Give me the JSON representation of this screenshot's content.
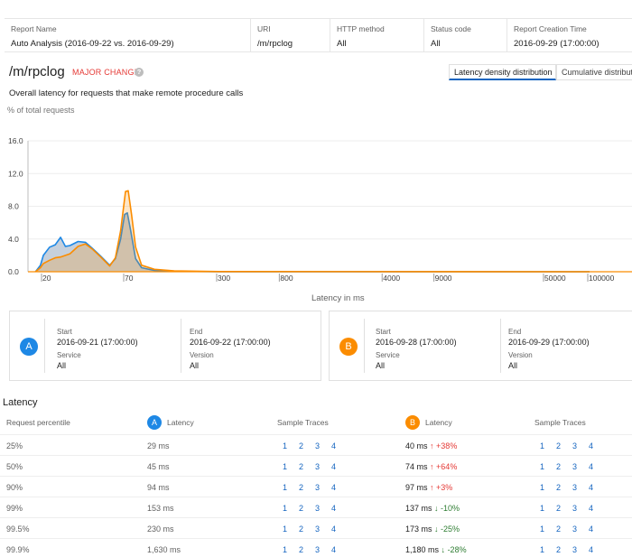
{
  "header": {
    "columns": [
      {
        "label": "Report Name",
        "value": "Auto Analysis (2016-09-22 vs. 2016-09-29)"
      },
      {
        "label": "URI",
        "value": "/m/rpclog"
      },
      {
        "label": "HTTP method",
        "value": "All"
      },
      {
        "label": "Status code",
        "value": "All"
      },
      {
        "label": "Report Creation Time",
        "value": "2016-09-29 (17:00:00)"
      }
    ]
  },
  "page": {
    "title": "/m/rpclog",
    "badge": "MAJOR CHANGE",
    "help_glyph": "?",
    "subtitle": "Overall latency for requests that make remote procedure calls",
    "toggle_density": "Latency density distribution",
    "toggle_cumulative": "Cumulative distributi"
  },
  "chart_data": {
    "type": "area",
    "ylabel": "% of total requests",
    "xlabel": "Latency in ms",
    "y_ticks": [
      "16.0",
      "12.0",
      "8.0",
      "4.0",
      "0.0"
    ],
    "ylim": [
      0,
      16
    ],
    "x_ticks": [
      "20",
      "70",
      "300",
      "800",
      "4000",
      "9000",
      "50000",
      "100000"
    ],
    "x_scale": "log",
    "series": [
      {
        "color": "#1e88e5",
        "points": [
          [
            15,
            0
          ],
          [
            18,
            0.8
          ],
          [
            20,
            2.0
          ],
          [
            22,
            3.0
          ],
          [
            24,
            3.3
          ],
          [
            26,
            4.2
          ],
          [
            28,
            3.1
          ],
          [
            30,
            3.2
          ],
          [
            34,
            3.7
          ],
          [
            38,
            3.6
          ],
          [
            42,
            2.9
          ],
          [
            48,
            1.9
          ],
          [
            55,
            0.8
          ],
          [
            60,
            1.6
          ],
          [
            65,
            4.0
          ],
          [
            69,
            7.0
          ],
          [
            72,
            7.2
          ],
          [
            76,
            5.0
          ],
          [
            82,
            1.6
          ],
          [
            90,
            0.5
          ],
          [
            110,
            0.15
          ],
          [
            150,
            0.05
          ],
          [
            300,
            0
          ],
          [
            100000,
            0
          ]
        ]
      },
      {
        "color": "#fb8c00",
        "points": [
          [
            15,
            0
          ],
          [
            18,
            0.5
          ],
          [
            20,
            1.0
          ],
          [
            22,
            1.4
          ],
          [
            24,
            1.7
          ],
          [
            26,
            1.8
          ],
          [
            30,
            2.2
          ],
          [
            34,
            3.1
          ],
          [
            38,
            3.4
          ],
          [
            42,
            2.8
          ],
          [
            48,
            1.8
          ],
          [
            55,
            0.7
          ],
          [
            60,
            1.7
          ],
          [
            65,
            5.0
          ],
          [
            70,
            9.8
          ],
          [
            73,
            9.9
          ],
          [
            77,
            7.0
          ],
          [
            82,
            3.0
          ],
          [
            90,
            0.8
          ],
          [
            110,
            0.3
          ],
          [
            150,
            0.1
          ],
          [
            300,
            0.02
          ],
          [
            100000,
            0
          ]
        ]
      }
    ]
  },
  "snapshots": {
    "a": {
      "letter": "A",
      "start_label": "Start",
      "start": "2016-09-21 (17:00:00)",
      "end_label": "End",
      "end": "2016-09-22 (17:00:00)",
      "service_label": "Service",
      "service": "All",
      "version_label": "Version",
      "version": "All"
    },
    "b": {
      "letter": "B",
      "start_label": "Start",
      "start": "2016-09-28 (17:00:00)",
      "end_label": "End",
      "end": "2016-09-29 (17:00:00)",
      "service_label": "Service",
      "service": "All",
      "version_label": "Version",
      "version": "All"
    }
  },
  "latency": {
    "title": "Latency",
    "headers": {
      "percentile": "Request percentile",
      "latency_a": "Latency",
      "traces_a": "Sample Traces",
      "latency_b": "Latency",
      "traces_b": "Sample Traces"
    },
    "trace_links": [
      "1",
      "2",
      "3",
      "4"
    ],
    "rows": [
      {
        "percentile": "25%",
        "a": "29 ms",
        "b": "40 ms",
        "arrow": "↑",
        "change": "+38%",
        "dir": "up"
      },
      {
        "percentile": "50%",
        "a": "45 ms",
        "b": "74 ms",
        "arrow": "↑",
        "change": "+64%",
        "dir": "up"
      },
      {
        "percentile": "90%",
        "a": "94 ms",
        "b": "97 ms",
        "arrow": "↑",
        "change": "+3%",
        "dir": "up"
      },
      {
        "percentile": "99%",
        "a": "153 ms",
        "b": "137 ms",
        "arrow": "↓",
        "change": "-10%",
        "dir": "down"
      },
      {
        "percentile": "99.5%",
        "a": "230 ms",
        "b": "173 ms",
        "arrow": "↓",
        "change": "-25%",
        "dir": "down"
      },
      {
        "percentile": "99.9%",
        "a": "1,630 ms",
        "b": "1,180 ms",
        "arrow": "↓",
        "change": "-28%",
        "dir": "down"
      }
    ]
  }
}
